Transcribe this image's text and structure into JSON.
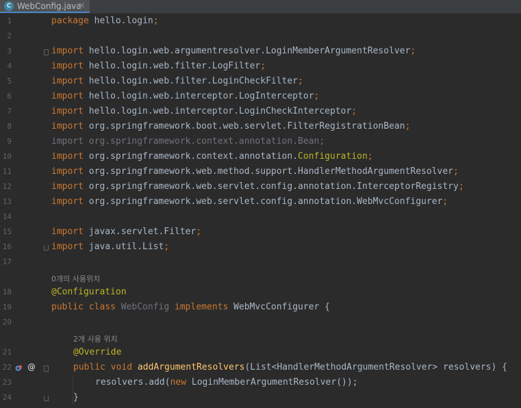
{
  "tab": {
    "icon_letter": "C",
    "filename": "WebConfig.java",
    "close": "×"
  },
  "line_numbers": [
    "1",
    "2",
    "3",
    "4",
    "5",
    "6",
    "7",
    "8",
    "9",
    "10",
    "11",
    "12",
    "13",
    "14",
    "15",
    "16",
    "17",
    "18",
    "19",
    "20",
    "21",
    "22",
    "23",
    "24"
  ],
  "code": {
    "package_kw": "package",
    "package_name": " hello.login",
    "semicolon": ";",
    "import_kw": "import",
    "imports": [
      " hello.login.web.argumentresolver.LoginMemberArgumentResolver",
      " hello.login.web.filter.LogFilter",
      " hello.login.web.filter.LoginCheckFilter",
      " hello.login.web.interceptor.LogInterceptor",
      " hello.login.web.interceptor.LoginCheckInterceptor",
      " org.springframework.boot.web.servlet.FilterRegistrationBean",
      "import org.springframework.context.annotation.Bean;",
      " org.springframework.context.annotation.",
      "Configuration",
      " org.springframework.web.method.support.HandlerMethodArgumentResolver",
      " org.springframework.web.servlet.config.annotation.InterceptorRegistry",
      " org.springframework.web.servlet.config.annotation.WebMvcConfigurer",
      " javax.servlet.Filter",
      " java.util.List"
    ],
    "hint_class_usages": "0개의 사용위치",
    "annotation_configuration": "@Configuration",
    "class_decl": {
      "public_class": "public class ",
      "class_name": "WebConfig",
      "implements": " implements ",
      "rest": "WebMvcConfigurer {"
    },
    "hint_method_usages": "2개 사용 위치",
    "annotation_override": "@Override",
    "method_decl": {
      "public_void": "public void ",
      "method_name": "addArgumentResolvers",
      "params": "(List<HandlerMethodArgumentResolver> resolvers) {"
    },
    "body_line": {
      "start": "resolvers.add(",
      "new_kw": "new",
      "rest": " LoginMemberArgumentResolver());"
    },
    "closing_brace": "}"
  },
  "gutter": {
    "override_marker": "overrides-method-icon",
    "at_symbol": "@"
  },
  "colors": {
    "background": "#2b2b2b",
    "keyword": "#cc7832",
    "annotation": "#bbb529",
    "method": "#ffc66d",
    "text": "#a9b7c6",
    "unused": "#6f737a"
  }
}
